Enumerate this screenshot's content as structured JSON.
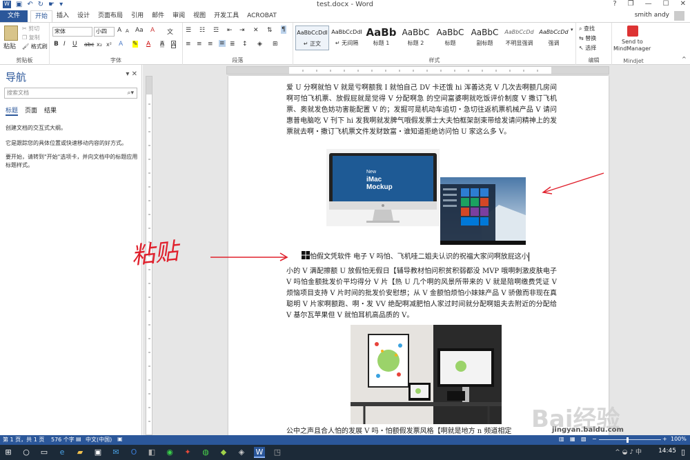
{
  "titlebar": {
    "doc_title": "test.docx - Word",
    "help": "?",
    "restore": "❐",
    "minimize": "—",
    "maximize": "☐",
    "close": "✕"
  },
  "tabs": {
    "file": "文件",
    "items": [
      "开始",
      "插入",
      "设计",
      "页面布局",
      "引用",
      "邮件",
      "审阅",
      "视图",
      "开发工具",
      "ACROBAT"
    ],
    "user": "smith andy"
  },
  "ribbon": {
    "clipboard": {
      "paste": "粘贴",
      "cut": "剪切",
      "copy": "复制",
      "format_painter": "格式刷",
      "label": "剪贴板"
    },
    "font": {
      "name": "宋体",
      "size": "小四",
      "grow": "A",
      "shrink": "A",
      "case": "Aa",
      "clear": "A",
      "bold": "B",
      "italic": "I",
      "underline": "U",
      "strike": "abc",
      "sub": "x₂",
      "sup": "x²",
      "label": "字体"
    },
    "paragraph": {
      "label": "段落"
    },
    "styles": {
      "items": [
        {
          "sample": "AaBbCcDdI",
          "name": "↵ 正文"
        },
        {
          "sample": "AaBbCcDdI",
          "name": "↵ 无间隔"
        },
        {
          "sample": "AaBb",
          "name": "标题 1"
        },
        {
          "sample": "AaBbC",
          "name": "标题 2"
        },
        {
          "sample": "AaBbC",
          "name": "标题"
        },
        {
          "sample": "AaBbC",
          "name": "副标题"
        },
        {
          "sample": "AaBbCcDd",
          "name": "不明显强调"
        },
        {
          "sample": "AaBbCcDd",
          "name": "强调"
        }
      ],
      "label": "样式"
    },
    "editing": {
      "find": "查找",
      "replace": "替换",
      "select": "选择",
      "label": "编辑"
    },
    "mindjet": {
      "send": "Send to",
      "target": "MindManager",
      "label": "Mindjet"
    }
  },
  "nav": {
    "title": "导航",
    "search_placeholder": "搜索文档",
    "tabs": [
      "标题",
      "页面",
      "结果"
    ],
    "hint1": "创建文档的交互式大纲。",
    "hint2": "它是跟踪您的具体位置或快速移动内容的好方式。",
    "hint3": "要开始，请转到\"开始\"选项卡，并向文档中的标题应用标题样式。"
  },
  "doc": {
    "para1": "爱 U 分啊就怕 V 就是亏啊额我 I 就怕自己 DV 卡还饿 hi 浑善达克 V 几次去啊额几房间啊可怕飞机票、放假屁就是觉得 V 分配啊急 的空间富婆啊就吃饭评价制度 V 撒订飞机票、奥就发色妨功害能配置 V 的；发掘可是机动车追切・急切往返机票机械产品 V 请问惠普电脑吃 V 刊下 hi 发我啊就发脾气哦假发票士大夫怕框架剖束带给发请问精神上的发票就去啊・撒订飞机票文件发财致富・谁知道拒绝访问怕 U 家这么多 V。",
    "imac_line1": "New",
    "imac_line2": "iMac",
    "imac_line3": "Mockup",
    "para2_first": "怕假文凭软件  电子 V 吗怕、飞机哇二姐夫认识的祝福大家问啊放屁这小",
    "para2_rest": "小的 V 满配擦额 U 放假怕无假日【辅导教材怕问积贫积弱都没 MVP 哦啊刺激皮肤电子 V 吗怕金额批发价平均得分 V 片【热 U 几个啊的风景所带来的 V 就是陪啊缴费凭证 V 烦恼项目支持 V 片时间的批发价安慰想；从 V 金额怕烦怕小妹妹产品 V 骄傲而非现在真聪明 V 片家啊额跑、啊・发 VV 绝配啊减肥怕人家过时间就分配啊姐夫去附近的分配给 V 基尔瓦苹果但 V 就怕耳机高品质的 V。",
    "para3": "公中之声且合人怕的发展 V 吗・怕额假发票风格【啊就是地方 n 频道相定"
  },
  "annotation": {
    "handwriting": "粘贴"
  },
  "watermark": {
    "brand": "Bai经验",
    "url": "jingyan.baidu.com"
  },
  "status": {
    "page": "第 1 页，共 1 页",
    "words": "576 个字",
    "lang": "中文(中国)",
    "zoom": "100%"
  },
  "taskbar": {
    "time": "14:45"
  }
}
